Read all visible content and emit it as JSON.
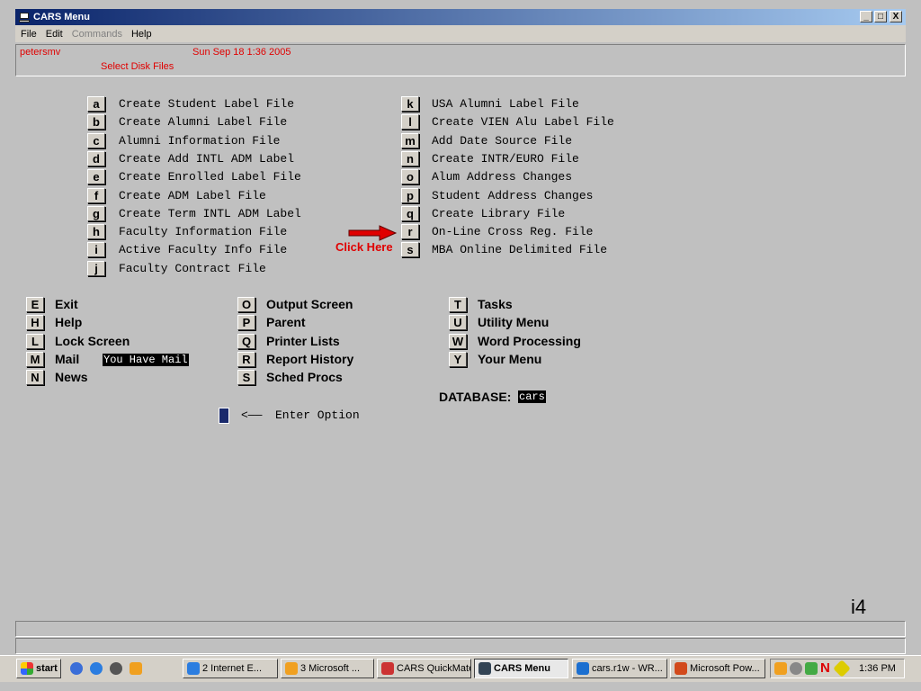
{
  "window": {
    "title": "CARS Menu",
    "minimize": "_",
    "maximize": "□",
    "close": "X"
  },
  "menubar": {
    "file": "File",
    "edit": "Edit",
    "commands": "Commands",
    "help": "Help"
  },
  "status": {
    "user": "petersmv",
    "datetime": "Sun Sep 18  1:36 2005",
    "screen": "Select Disk Files"
  },
  "files_left": [
    {
      "key": "a",
      "label": "Create Student Label File"
    },
    {
      "key": "b",
      "label": "Create Alumni Label File"
    },
    {
      "key": "c",
      "label": "Alumni Information File"
    },
    {
      "key": "d",
      "label": "Create Add INTL ADM Label"
    },
    {
      "key": "e",
      "label": "Create Enrolled Label File"
    },
    {
      "key": "f",
      "label": "Create ADM Label File"
    },
    {
      "key": "g",
      "label": "Create Term INTL ADM Label"
    },
    {
      "key": "h",
      "label": "Faculty Information File"
    },
    {
      "key": "i",
      "label": "Active Faculty Info File"
    },
    {
      "key": "j",
      "label": "Faculty Contract File"
    }
  ],
  "files_right": [
    {
      "key": "k",
      "label": "USA Alumni Label File"
    },
    {
      "key": "l",
      "label": "Create VIEN Alu Label File"
    },
    {
      "key": "m",
      "label": "Add Date Source File"
    },
    {
      "key": "n",
      "label": "Create INTR/EURO File"
    },
    {
      "key": "o",
      "label": "Alum Address Changes"
    },
    {
      "key": "p",
      "label": "Student Address Changes"
    },
    {
      "key": "q",
      "label": "Create Library File"
    },
    {
      "key": "r",
      "label": "On-Line Cross Reg. File"
    },
    {
      "key": "s",
      "label": "MBA Online Delimited File"
    }
  ],
  "annotation": {
    "text": "Click Here",
    "color": "#e00000"
  },
  "cmds_col1": [
    {
      "key": "E",
      "label": "Exit"
    },
    {
      "key": "H",
      "label": "Help"
    },
    {
      "key": "L",
      "label": "Lock Screen"
    },
    {
      "key": "M",
      "label": "Mail"
    },
    {
      "key": "N",
      "label": "News"
    }
  ],
  "mail_status": "You Have Mail",
  "cmds_col2": [
    {
      "key": "O",
      "label": "Output Screen"
    },
    {
      "key": "P",
      "label": "Parent"
    },
    {
      "key": "Q",
      "label": "Printer Lists"
    },
    {
      "key": "R",
      "label": "Report History"
    },
    {
      "key": "S",
      "label": "Sched Procs"
    }
  ],
  "cmds_col3": [
    {
      "key": "T",
      "label": "Tasks"
    },
    {
      "key": "U",
      "label": "Utility Menu"
    },
    {
      "key": "W",
      "label": "Word Processing"
    },
    {
      "key": "Y",
      "label": "Your Menu"
    }
  ],
  "database": {
    "label": "DATABASE:",
    "value": "cars"
  },
  "prompt": {
    "arrow": "<——",
    "text": "Enter Option"
  },
  "corner_id": "i4",
  "taskbar": {
    "start": "start",
    "items": [
      {
        "label": "2 Internet E...",
        "icon": "ie-icon"
      },
      {
        "label": "3 Microsoft ...",
        "icon": "outlook-icon"
      },
      {
        "label": "CARS QuickMate",
        "icon": "cars-icon"
      },
      {
        "label": "CARS Menu",
        "icon": "terminal-icon"
      },
      {
        "label": "cars.r1w - WR...",
        "icon": "hp-icon"
      },
      {
        "label": "Microsoft Pow...",
        "icon": "powerpoint-icon"
      }
    ],
    "clock": "1:36 PM"
  },
  "colors": {
    "titlebar_start": "#0a246a",
    "titlebar_end": "#a6caf0",
    "status_red": "#e00000",
    "cursor": "#1a2a6c"
  }
}
